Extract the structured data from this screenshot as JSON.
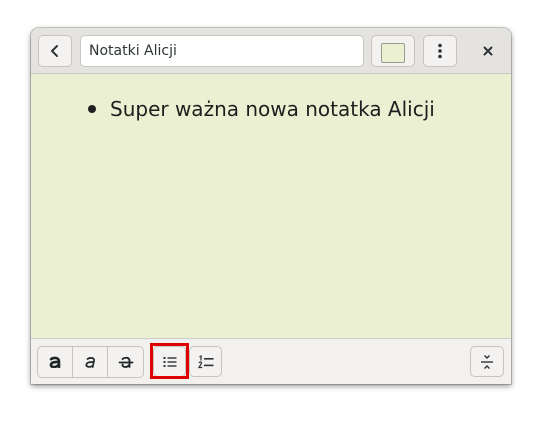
{
  "header": {
    "back_icon": "chevron-left-icon",
    "title_value": "Notatki Alicji",
    "color_button_color": "#ecf0d2",
    "menu_icon": "vertical-ellipsis-icon",
    "close_icon": "close-icon"
  },
  "note": {
    "items": [
      {
        "text": "Super ważna nowa notatka Alicji"
      }
    ]
  },
  "toolbar": {
    "buttons": [
      {
        "name": "bold-button",
        "icon": "bold-icon"
      },
      {
        "name": "italic-button",
        "icon": "italic-icon"
      },
      {
        "name": "strikethrough-button",
        "icon": "strikethrough-icon"
      },
      {
        "name": "bullet-list-button",
        "icon": "bullet-list-icon",
        "highlighted": true
      },
      {
        "name": "numbered-list-button",
        "icon": "numbered-list-icon"
      },
      {
        "name": "text-size-button",
        "icon": "text-size-icon"
      }
    ]
  },
  "colors": {
    "note_background": "#ecf0d2",
    "highlight": "#e00000"
  }
}
